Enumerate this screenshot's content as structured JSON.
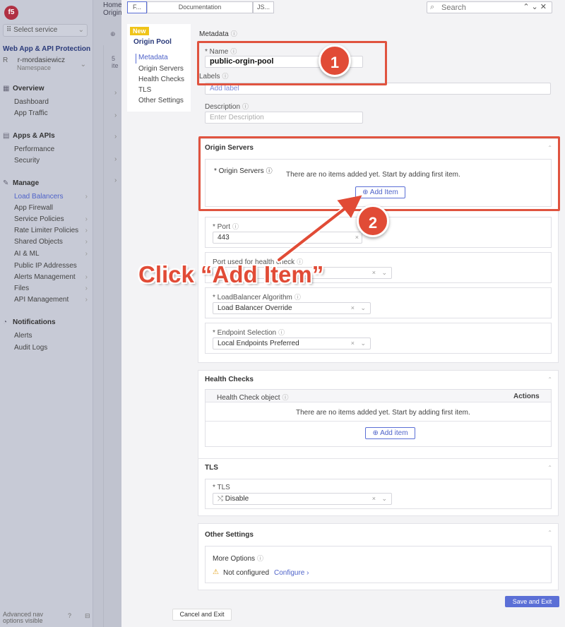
{
  "nav": {
    "logo": "f5",
    "select_service": "Select service",
    "app_title": "Web App & API Protection",
    "user_initial": "R",
    "user_name": "r-mordasiewicz",
    "namespace_label": "Namespace",
    "sections": [
      {
        "label": "Overview",
        "items": [
          "Dashboard",
          "App Traffic"
        ]
      },
      {
        "label": "Apps & APIs",
        "items": [
          "Performance",
          "Security"
        ]
      },
      {
        "label": "Manage",
        "items": [
          "Load Balancers",
          "App Firewall",
          "Service Policies",
          "Rate Limiter Policies",
          "Shared Objects",
          "AI & ML",
          "Public IP Addresses",
          "Alerts Management",
          "Files",
          "API Management"
        ]
      },
      {
        "label": "Notifications",
        "items": [
          "Alerts",
          "Audit Logs"
        ]
      }
    ],
    "footer": "Advanced nav options visible"
  },
  "mid": {
    "crumb_1": "Home",
    "crumb_2": "Origin",
    "count": "5 ite"
  },
  "topbar": {
    "tab_1": "F...",
    "tab_2": "Documentation",
    "tab_3": "JS...",
    "search_placeholder": "Search"
  },
  "sidemenu": {
    "badge": "New",
    "title": "Origin Pool",
    "links": [
      "Metadata",
      "Origin Servers",
      "Health Checks",
      "TLS",
      "Other Settings"
    ]
  },
  "metadata": {
    "title": "Metadata",
    "name_label": "Name",
    "name_value": "public-orgin-pool",
    "labels_label": "Labels",
    "add_label": "Add label",
    "description_label": "Description",
    "description_placeholder": "Enter Description"
  },
  "origin_servers": {
    "title": "Origin Servers",
    "field_label": "Origin Servers",
    "empty_msg": "There are no items added yet. Start by adding first item.",
    "add_button": "Add Item",
    "port_label": "Port",
    "port_value": "443",
    "health_port_label": "Port used for health check",
    "lb_algo_label": "LoadBalancer Algorithm",
    "lb_algo_value": "Load Balancer Override",
    "endpoint_label": "Endpoint Selection",
    "endpoint_value": "Local Endpoints Preferred"
  },
  "health_checks": {
    "title": "Health Checks",
    "col_object": "Health Check object",
    "col_actions": "Actions",
    "empty_msg": "There are no items added yet. Start by adding first item.",
    "add_button": "Add item"
  },
  "tls": {
    "title": "TLS",
    "field_label": "TLS",
    "value": "Disable"
  },
  "other_settings": {
    "title": "Other Settings",
    "more_options": "More Options",
    "status": "Not configured",
    "configure": "Configure"
  },
  "actions": {
    "save": "Save and Exit",
    "cancel": "Cancel and Exit"
  },
  "annotations": {
    "step_1": "1",
    "step_2": "2",
    "callout": "Click “Add Item”",
    "color": "#e14b36"
  }
}
